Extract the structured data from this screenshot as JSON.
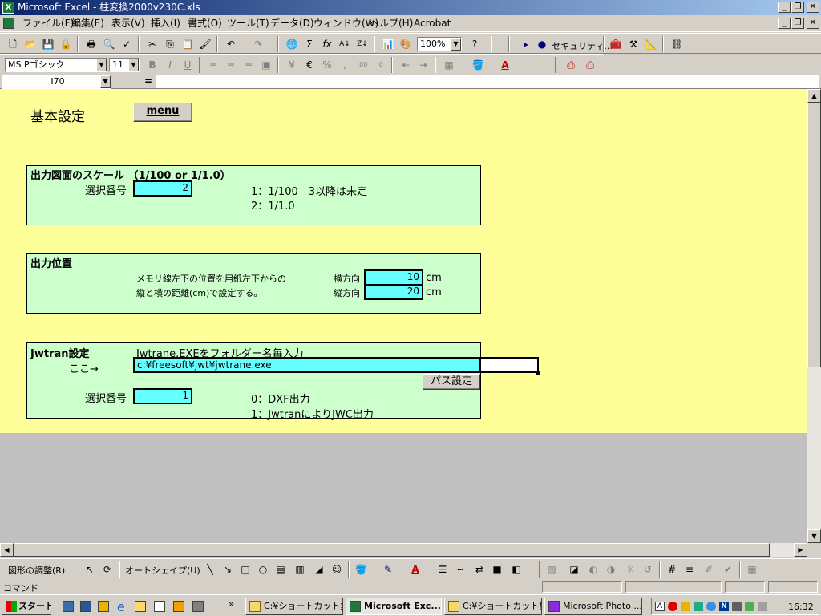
{
  "window": {
    "title": "Microsoft Excel - 柱変換2000v230C.xls",
    "icon": "excel-icon"
  },
  "menu": [
    {
      "label": "ファイル(F)"
    },
    {
      "label": "編集(E)"
    },
    {
      "label": "表示(V)"
    },
    {
      "label": "挿入(I)"
    },
    {
      "label": "書式(O)"
    },
    {
      "label": "ツール(T)"
    },
    {
      "label": "データ(D)"
    },
    {
      "label": "ウィンドウ(W)"
    },
    {
      "label": "ヘルプ(H)"
    },
    {
      "label": "Acrobat"
    }
  ],
  "toolbar": {
    "zoom": "100%",
    "security_label": "セキュリティ..."
  },
  "format": {
    "font": "MS Pゴシック",
    "size": "11"
  },
  "formula_bar": {
    "name_box": "I70",
    "equals": "=",
    "value": ""
  },
  "sheet": {
    "heading": "基本設定",
    "menu_button": "menu",
    "scale": {
      "title": "出力図面のスケール （1/100 or 1/1.0）",
      "select_label": "選択番号",
      "select_value": "2",
      "option1": "1：1/100　3以降は未定",
      "option2": "2：1/1.0"
    },
    "position": {
      "title": "出力位置",
      "desc1": "メモリ線左下の位置を用紙左下からの",
      "desc2": "縦と横の距離(cm)で設定する。",
      "h_label": "横方向",
      "h_value": "10",
      "v_label": "縦方向",
      "v_value": "20",
      "unit": "cm"
    },
    "jwtran": {
      "title": "Jwtran設定",
      "desc": "Jwtrane.EXEをフォルダー名毎入力",
      "here": "ここ→",
      "path": "c:¥freesoft¥jwt¥jwtrane.exe",
      "path_button": "パス設定",
      "select_label": "選択番号",
      "select_value": "1",
      "option0": "0：DXF出力",
      "option1": "1：JwtranによりJWC出力"
    }
  },
  "drawing": {
    "adjust": "図形の調整(R)",
    "autoshape": "オートシェイプ(U)"
  },
  "status": {
    "text": "コマンド"
  },
  "taskbar": {
    "start": "スタート",
    "tasks": [
      {
        "label": "C:¥ショートカット集..."
      },
      {
        "label": "Microsoft Exc..."
      },
      {
        "label": "C:¥ショートカット集..."
      },
      {
        "label": "Microsoft Photo ..."
      }
    ],
    "clock": "16:32"
  },
  "colors": {
    "sheet_bg": "#ffff99",
    "panel_bg": "#ccffcc",
    "input_bg": "#66ffff",
    "title_bar": "#0a246a"
  }
}
